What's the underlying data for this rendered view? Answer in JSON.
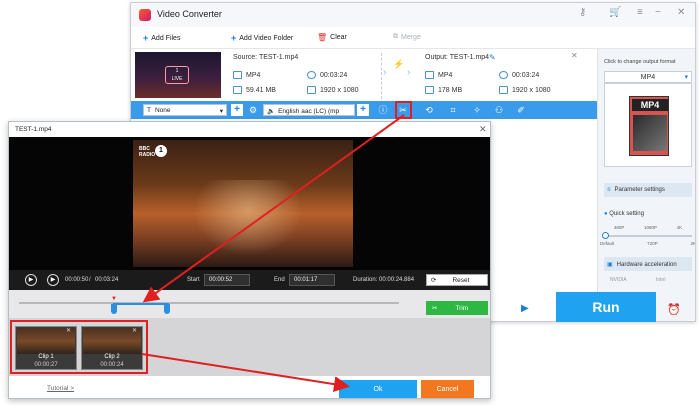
{
  "app": {
    "title": "Video Converter",
    "minimize_icon": "−",
    "close_icon": "✕"
  },
  "toolbar": {
    "add_files": "Add Files",
    "add_video_folder": "Add Video Folder",
    "clear": "Clear",
    "merge": "Merge"
  },
  "source": {
    "label": "Source: TEST-1.mp4",
    "format": "MP4",
    "duration": "00:03:24",
    "size": "59.41 MB",
    "resolution": "1920 x 1080"
  },
  "output": {
    "label": "Output: TEST-1.mp4",
    "format": "MP4",
    "duration": "00:03:24",
    "size": "178 MB",
    "resolution": "1920 x 1080"
  },
  "blue_bar": {
    "subtitle": "None",
    "audio": "English aac (LC) (mp"
  },
  "right_panel": {
    "header": "Click to change output format",
    "format": "MP4",
    "format_icon_text": "MP4",
    "parameter_settings": "Parameter settings",
    "quick_setting": "Quick setting",
    "slider_top": [
      "480P",
      "1080P",
      "4K"
    ],
    "slider_bottom": [
      "Default",
      "720P",
      "2K"
    ],
    "hardware_acceleration": "Hardware acceleration",
    "nvidia": "NVIDIA",
    "intel": "Intel"
  },
  "run_label": "Run",
  "dialog": {
    "title": "TEST-1.mp4",
    "close": "✕",
    "current_time": "00:00:50",
    "total_time": "00:03:24",
    "start_label": "Start",
    "start_value": "00:00:52",
    "end_label": "End",
    "end_value": "00:01:17",
    "duration_text": "Duration: 00:00:24.884",
    "reset_label": "Reset",
    "trim_label": "Trim",
    "tutorial": "Tutorial >",
    "ok": "Ok",
    "cancel": "Cancel",
    "clips": [
      {
        "name": "Clip 1",
        "duration": "00:00:27"
      },
      {
        "name": "Clip 2",
        "duration": "00:00:24"
      }
    ]
  },
  "colors": {
    "accent_blue": "#1fa3f0",
    "toolbar_blue": "#3a9bea",
    "trim_green": "#2db843",
    "cancel_orange": "#f2771e",
    "highlight_red": "#e02020"
  }
}
